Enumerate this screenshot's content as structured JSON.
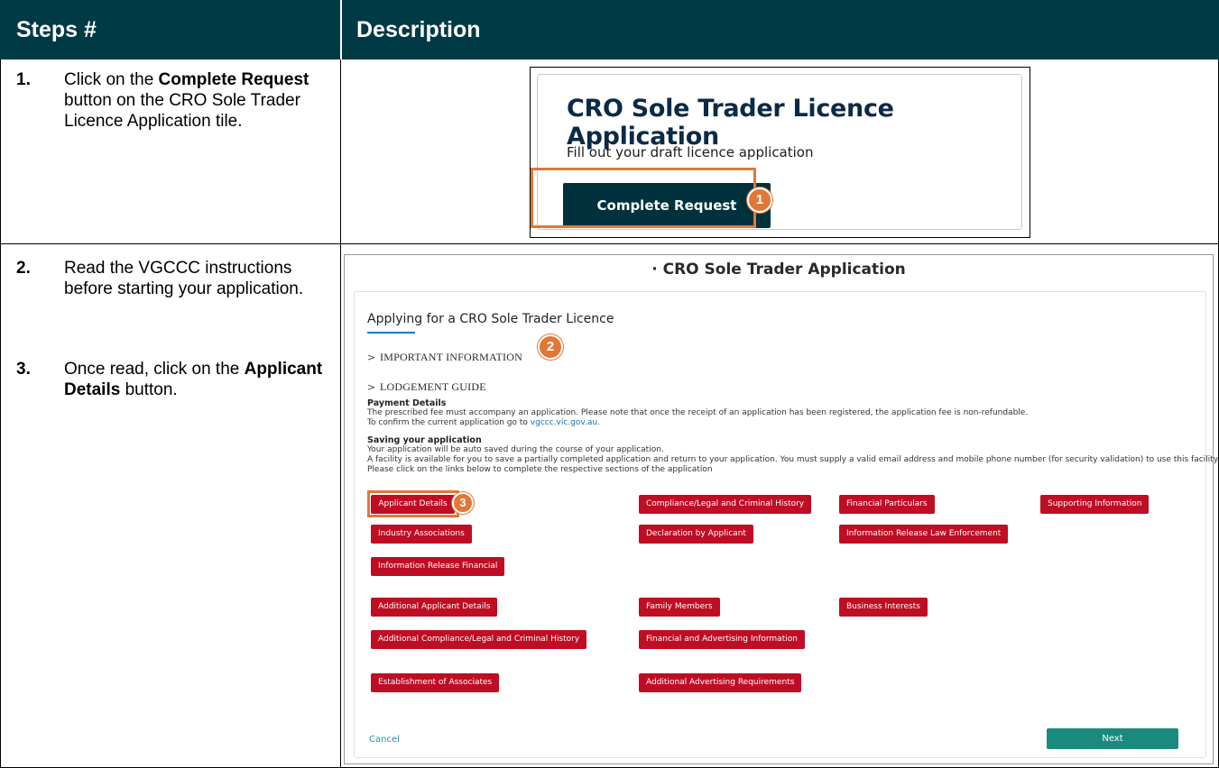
{
  "header": {
    "col_steps": "Steps #",
    "col_description": "Description"
  },
  "steps": [
    {
      "number": "1.",
      "pre": "Click on the ",
      "bold": "Complete Request",
      "post": " button on the CRO Sole Trader Licence Application tile."
    },
    {
      "number": "2.",
      "text": "Read the VGCCC instructions before starting your application."
    },
    {
      "number": "3.",
      "pre": "Once read, click on the ",
      "bold": "Applicant Details",
      "post": " button."
    }
  ],
  "tile": {
    "title": "CRO Sole Trader Licence Application",
    "subtitle": "Fill out your draft licence application",
    "button": "Complete Request",
    "badge": "1"
  },
  "form": {
    "title": "CRO Sole Trader Application",
    "heading": "Applying for a CRO Sole Trader Licence",
    "accordion_1": "IMPORTANT INFORMATION",
    "accordion_2": "LODGEMENT GUIDE",
    "badge_2": "2",
    "badge_3": "3",
    "payment_heading": "Payment Details",
    "payment_line_1": "The prescribed fee must accompany an application. Please note that once the receipt of an application has been registered, the application fee is non-refundable.",
    "payment_line_2_pre": "To confirm the current application go to ",
    "payment_link": "vgccc.vic.gov.au.",
    "saving_heading": "Saving your application",
    "saving_line_1": "Your application will be auto saved during the course of your application.",
    "saving_line_2": "A facility is available for you to save a partially completed application and return to your application. You must supply a valid email address and mobile phone number (for security validation) to use this facility.",
    "saving_line_3": "Please click on the links below to complete the respective sections of the application",
    "buttons": {
      "applicant_details": "Applicant Details",
      "compliance": "Compliance/Legal and Criminal History",
      "financial_particulars": "Financial Particulars",
      "supporting_information": "Supporting Information",
      "industry_associations": "Industry Associations",
      "declaration": "Declaration by Applicant",
      "info_release_law": "Information Release Law Enforcement",
      "info_release_financial": "Information Release Financial",
      "additional_applicant": "Additional Applicant Details",
      "family_members": "Family Members",
      "business_interests": "Business Interests",
      "additional_compliance": "Additional Compliance/Legal and Criminal History",
      "financial_advertising": "Financial and Advertising Information",
      "establishment_associates": "Establishment of Associates",
      "additional_advertising": "Additional Advertising Requirements"
    },
    "cancel": "Cancel",
    "next": "Next"
  },
  "colors": {
    "header_bg": "#003a45",
    "highlight": "#e07838",
    "red_button": "#bf0d24",
    "next_button": "#1a8a7e",
    "tile_button": "#00313c"
  }
}
